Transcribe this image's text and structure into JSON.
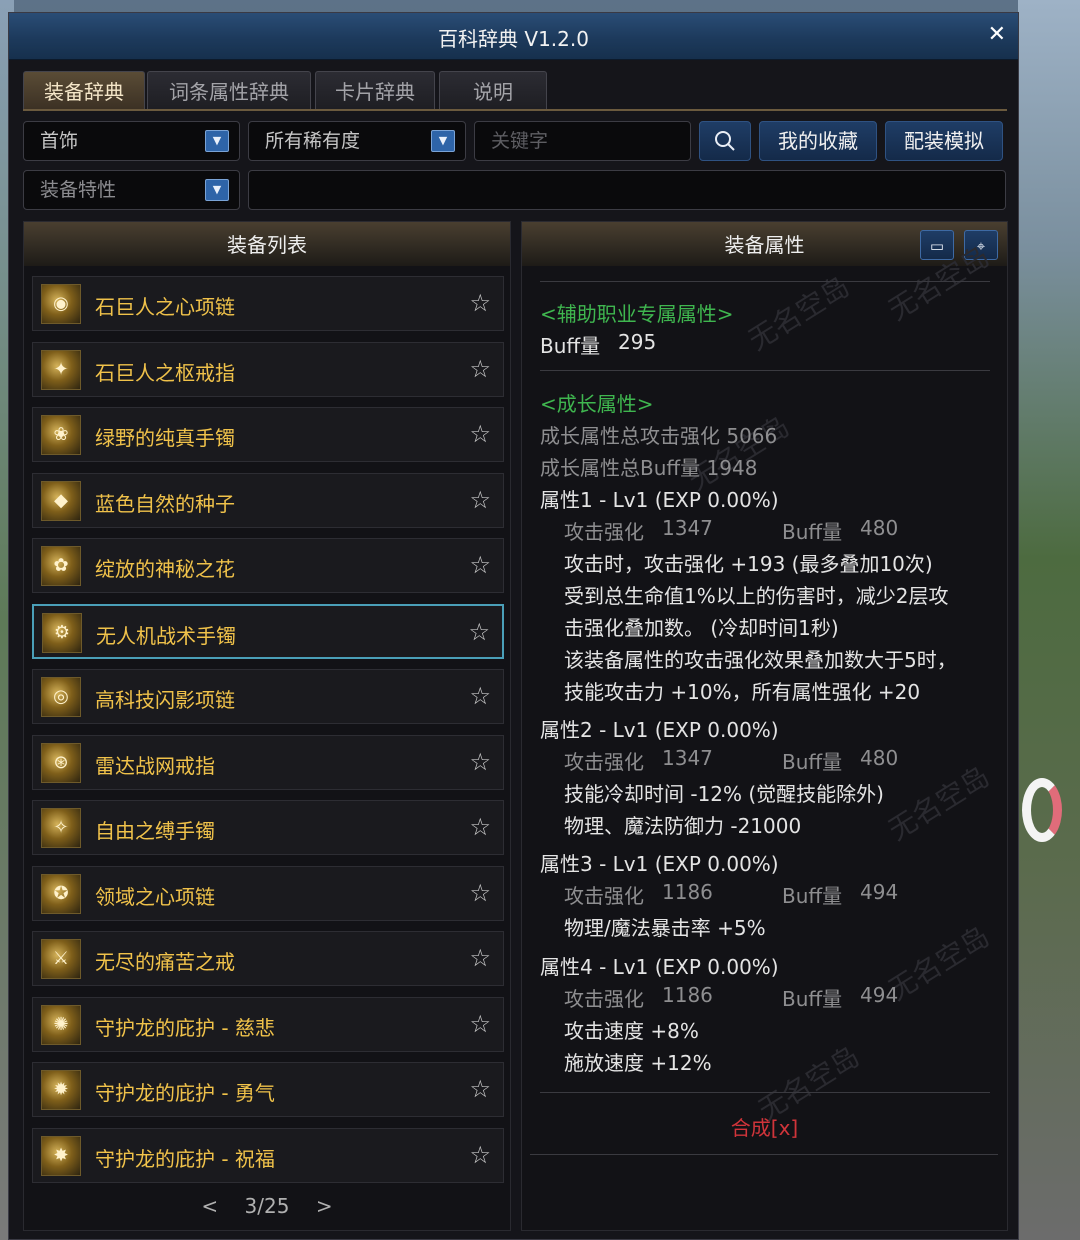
{
  "window": {
    "title": "百科辞典 V1.2.0",
    "close": "✕"
  },
  "tabs": [
    "装备辞典",
    "词条属性辞典",
    "卡片辞典",
    "说明"
  ],
  "filters": {
    "category": "首饰",
    "rarity": "所有稀有度",
    "keyword_placeholder": "关键字",
    "trait": "装备特性",
    "search_icon": "search-icon",
    "favorites_label": "我的收藏",
    "sim_label": "配装模拟"
  },
  "list": {
    "header": "装备列表",
    "items": [
      {
        "name": "石巨人之心项链"
      },
      {
        "name": "石巨人之枢戒指"
      },
      {
        "name": "绿野的纯真手镯"
      },
      {
        "name": "蓝色自然的种子"
      },
      {
        "name": "绽放的神秘之花"
      },
      {
        "name": "无人机战术手镯"
      },
      {
        "name": "高科技闪影项链"
      },
      {
        "name": "雷达战网戒指"
      },
      {
        "name": "自由之缚手镯"
      },
      {
        "name": "领域之心项链"
      },
      {
        "name": "无尽的痛苦之戒"
      },
      {
        "name": "守护龙的庇护 - 慈悲"
      },
      {
        "name": "守护龙的庇护 - 勇气"
      },
      {
        "name": "守护龙的庇护 - 祝福"
      }
    ],
    "selected_index": 5,
    "pager": {
      "prev": "<",
      "current": "3/25",
      "next": ">"
    }
  },
  "detail": {
    "header": "装备属性",
    "support_title": "<辅助职业专属属性>",
    "buff_label": "Buff量",
    "buff_value": "295",
    "growth_title": "<成长属性>",
    "growth_total_atk": "成长属性总攻击强化 5066",
    "growth_total_buff": "成长属性总Buff量 1948",
    "attrs": [
      {
        "title": "属性1 - Lv1 (EXP 0.00%)",
        "atk_label": "攻击强化",
        "atk": "1347",
        "buff_label": "Buff量",
        "buff": "480",
        "lines": [
          "攻击时，攻击强化 +193 (最多叠加10次)",
          "受到总生命值1%以上的伤害时，减少2层攻",
          "击强化叠加数。 (冷却时间1秒)",
          "该装备属性的攻击强化效果叠加数大于5时，",
          "技能攻击力 +10%，所有属性强化 +20"
        ]
      },
      {
        "title": "属性2 - Lv1 (EXP 0.00%)",
        "atk_label": "攻击强化",
        "atk": "1347",
        "buff_label": "Buff量",
        "buff": "480",
        "lines": [
          "技能冷却时间 -12% (觉醒技能除外)",
          "物理、魔法防御力 -21000"
        ]
      },
      {
        "title": "属性3 - Lv1 (EXP 0.00%)",
        "atk_label": "攻击强化",
        "atk": "1186",
        "buff_label": "Buff量",
        "buff": "494",
        "lines": [
          "物理/魔法暴击率 +5%"
        ]
      },
      {
        "title": "属性4 - Lv1 (EXP 0.00%)",
        "atk_label": "攻击强化",
        "atk": "1186",
        "buff_label": "Buff量",
        "buff": "494",
        "lines": [
          "攻击速度 +8%",
          "施放速度 +12%"
        ]
      }
    ],
    "synth": "合成[x]"
  },
  "watermark": "无名空岛",
  "colors": {
    "accent_gold": "#f0c24a",
    "title_blue": "#1d3a5c",
    "attr_green": "#3fb64f",
    "synth_red": "#d0343a",
    "select_cyan": "#4a9fb8"
  }
}
